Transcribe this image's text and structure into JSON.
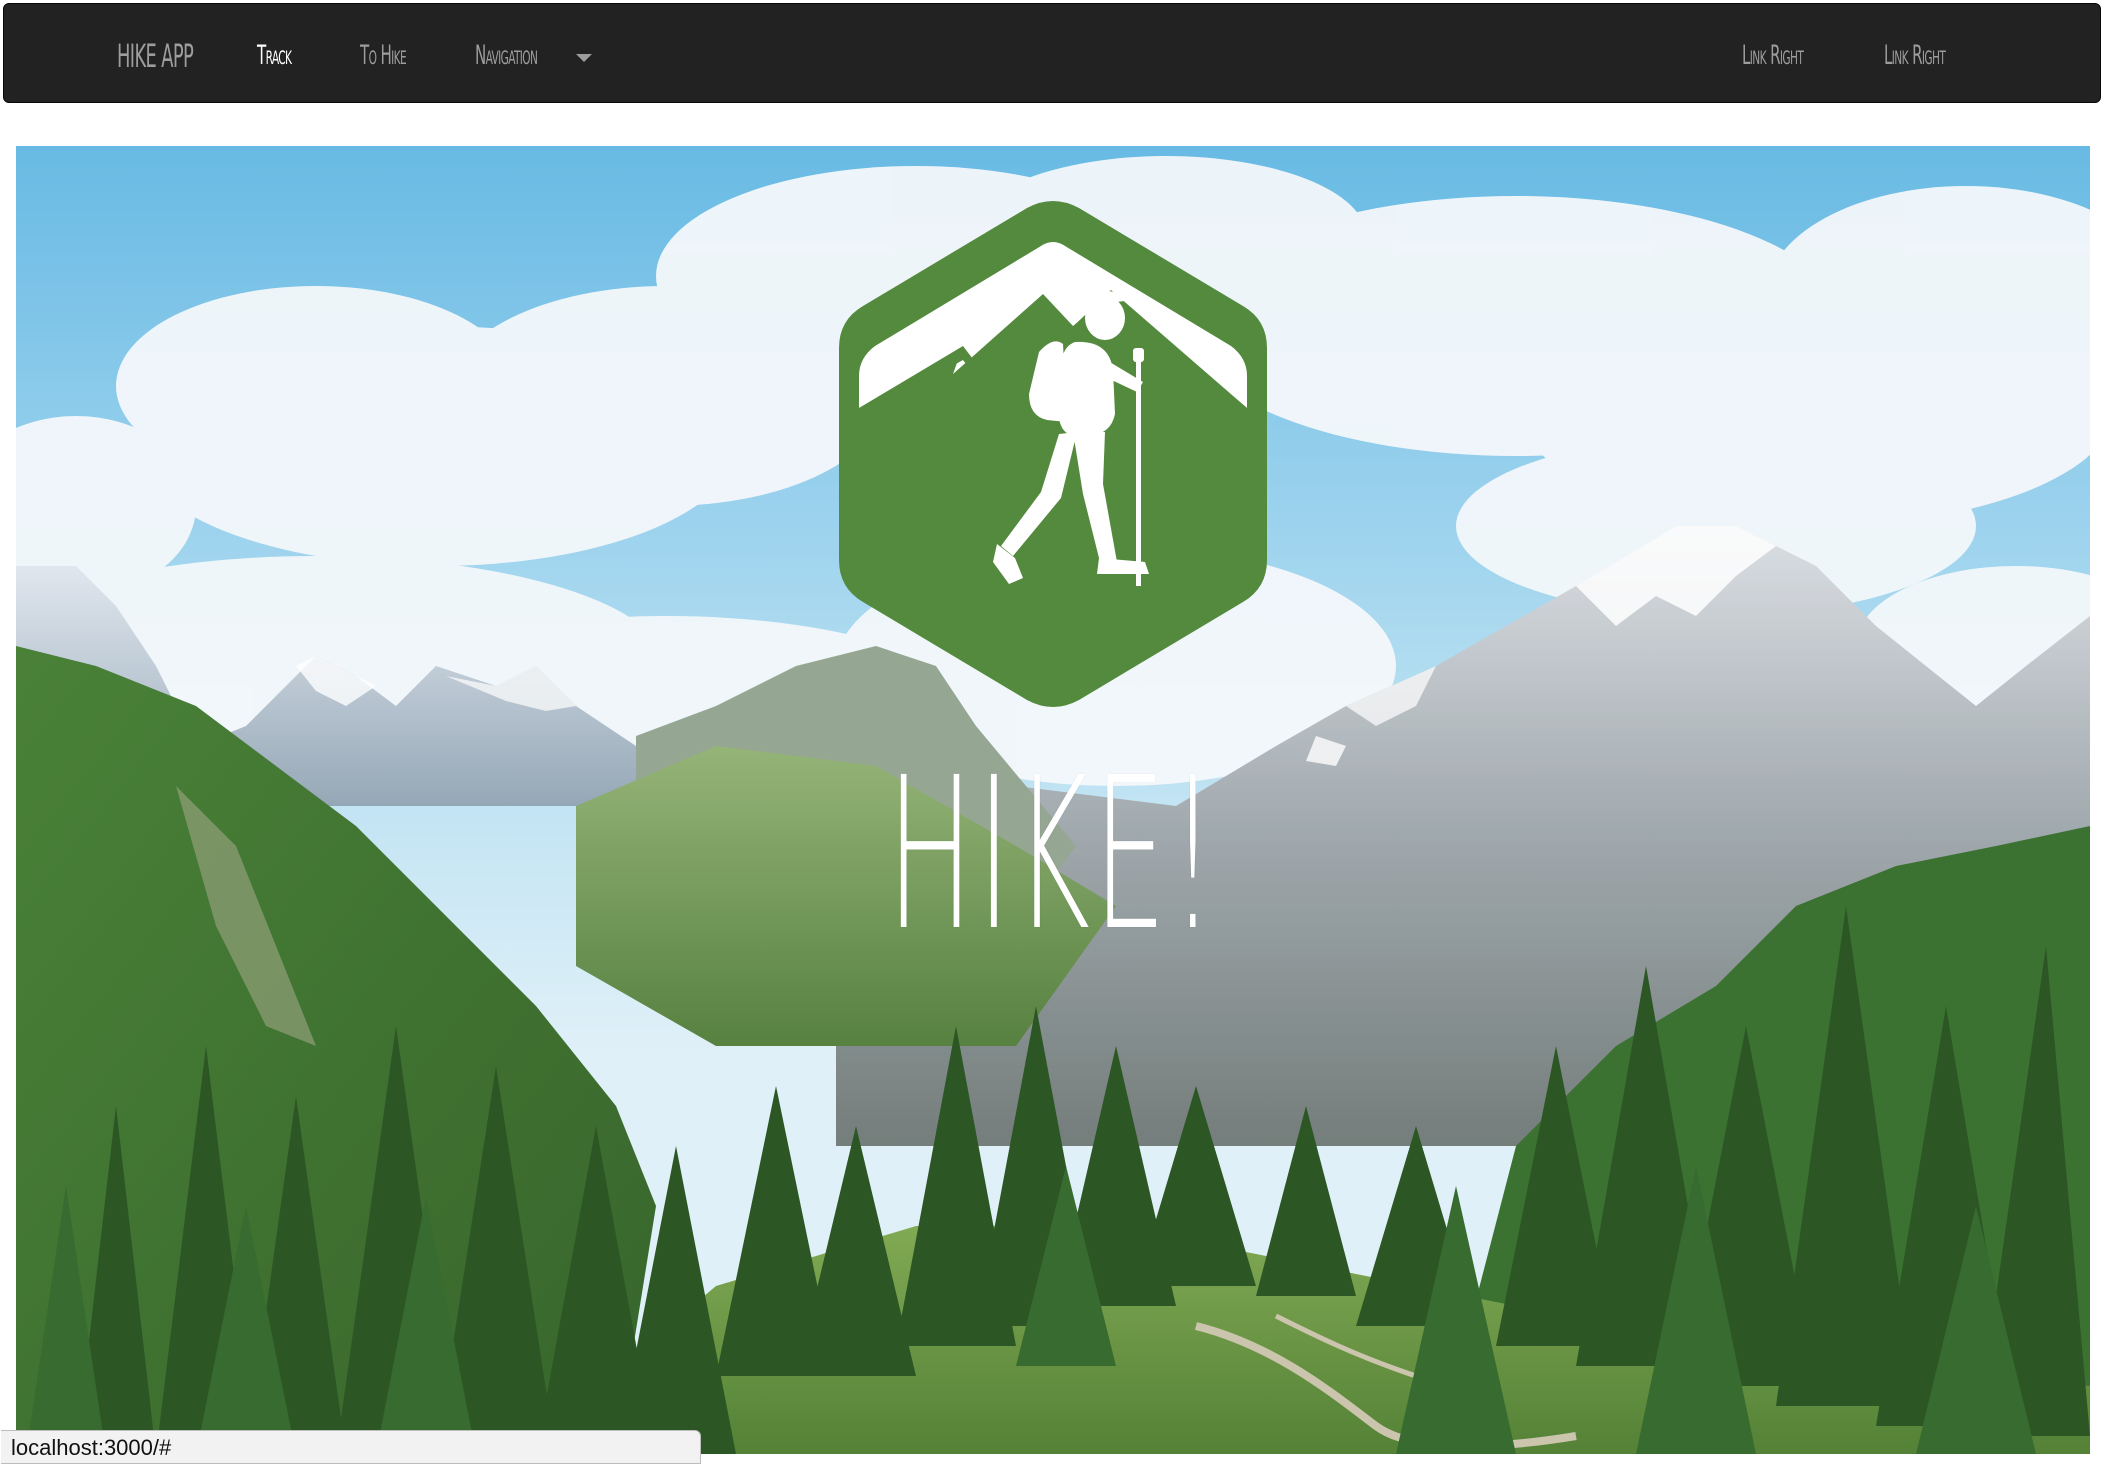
{
  "navbar": {
    "brand": "HIKE APP",
    "items": [
      {
        "label": "Track",
        "active": true
      },
      {
        "label": "To Hike",
        "active": false
      },
      {
        "label": "Navigation",
        "active": false,
        "dropdown": true
      }
    ],
    "right_items": [
      {
        "label": "Link Right"
      },
      {
        "label": "Link Right"
      }
    ]
  },
  "hero": {
    "logo_icon": "hiker-mountain-hexagon-icon",
    "title": "HIKE!",
    "logo_color": "#548a3e"
  },
  "statusbar": {
    "url": "localhost:3000/#"
  }
}
